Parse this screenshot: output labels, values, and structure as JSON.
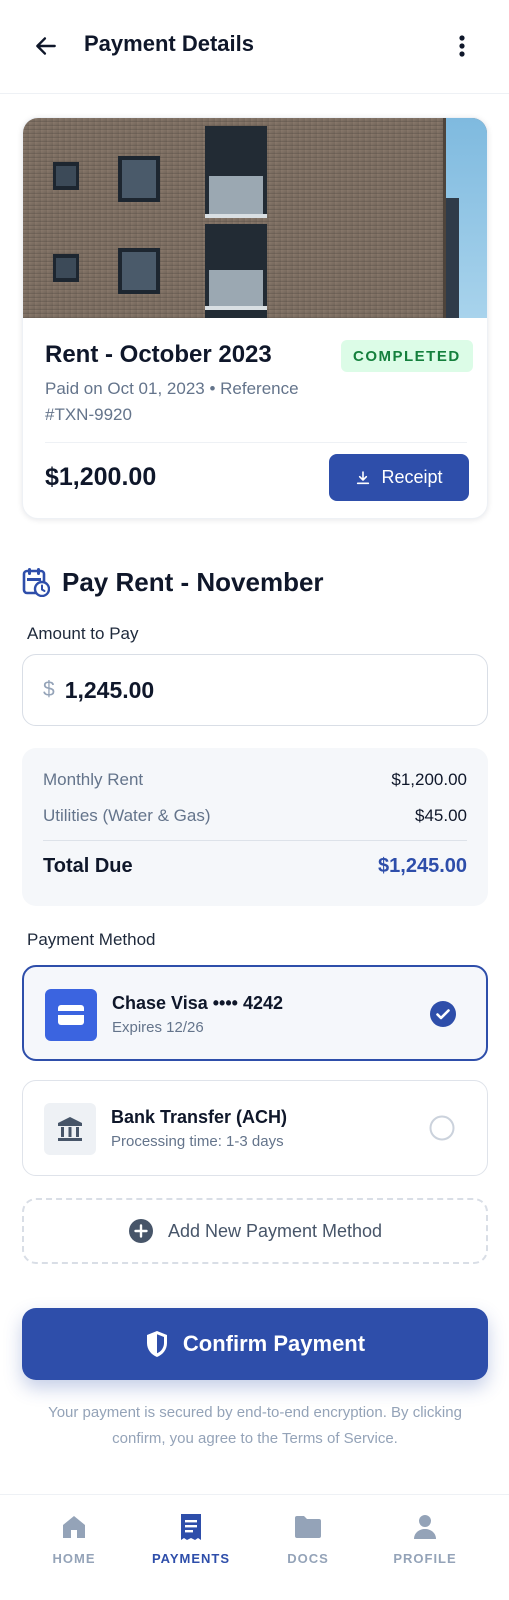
{
  "header": {
    "title": "Payment Details",
    "back_icon": "arrow-left-icon",
    "more_icon": "more-vertical-icon"
  },
  "transaction": {
    "title": "Rent - October 2023",
    "status": "COMPLETED",
    "subtitle": "Paid on Oct 01, 2023 • Reference #TXN-9920",
    "amount": "$1,200.00",
    "receipt_label": "Receipt",
    "receipt_icon": "download-icon"
  },
  "pay_section": {
    "title": "Pay Rent - November",
    "icon": "calendar-clock-icon",
    "amount_label": "Amount to Pay",
    "currency_symbol": "$",
    "amount_value": "1,245.00"
  },
  "breakdown": {
    "items": [
      {
        "label": "Monthly Rent",
        "value": "$1,200.00"
      },
      {
        "label": "Utilities (Water & Gas)",
        "value": "$45.00"
      }
    ],
    "total_label": "Total Due",
    "total_value": "$1,245.00"
  },
  "payment_methods": {
    "label": "Payment Method",
    "items": [
      {
        "name": "Chase Visa •••• 4242",
        "detail": "Expires 12/26",
        "icon": "credit-card-icon",
        "selected": true
      },
      {
        "name": "Bank Transfer (ACH)",
        "detail": "Processing time: 1-3 days",
        "icon": "bank-icon",
        "selected": false
      }
    ],
    "add_label": "Add New Payment Method"
  },
  "confirm": {
    "label": "Confirm Payment",
    "icon": "shield-icon",
    "note": "Your payment is secured by end-to-end encryption. By clicking confirm, you agree to the Terms of Service."
  },
  "nav": {
    "items": [
      {
        "label": "HOME",
        "icon": "home-icon",
        "active": false
      },
      {
        "label": "PAYMENTS",
        "icon": "receipt-icon",
        "active": true
      },
      {
        "label": "DOCS",
        "icon": "folder-icon",
        "active": false
      },
      {
        "label": "PROFILE",
        "icon": "person-icon",
        "active": false
      }
    ]
  },
  "colors": {
    "primary": "#2e4eaa",
    "success_bg": "#dcfce7",
    "success_text": "#15803d",
    "muted": "#64748b"
  }
}
